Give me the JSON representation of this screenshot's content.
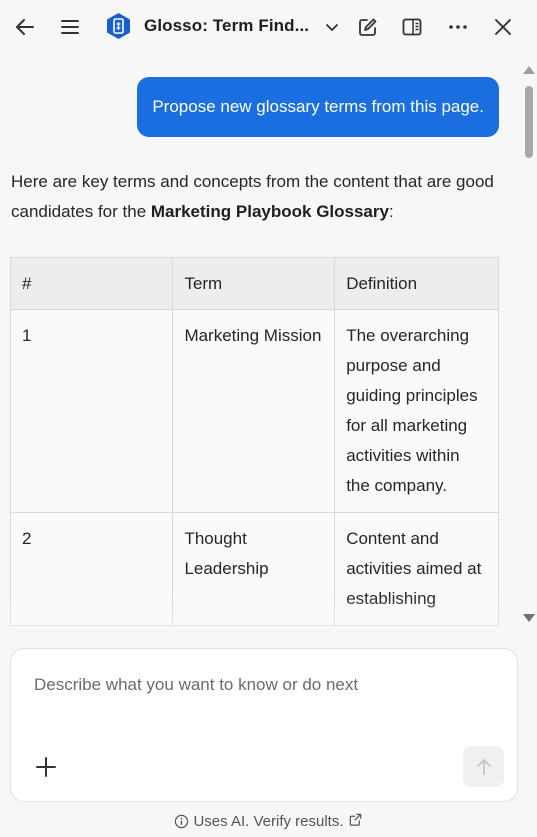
{
  "header": {
    "app_title": "Glosso: Term Find...",
    "icons": [
      "back-arrow-icon",
      "menu-icon",
      "app-logo",
      "chevron-down-icon",
      "edit-icon",
      "sidebar-toggle-icon",
      "more-icon",
      "close-icon"
    ]
  },
  "conversation": {
    "user_message": "Propose new glossary terms from this page.",
    "reply_intro": "Here are key terms and concepts from the content that are good candidates for the ",
    "reply_bold": "Marketing Playbook Glossary",
    "reply_end": ":",
    "table": {
      "headers": [
        "#",
        "Term",
        "Definition"
      ],
      "rows": [
        {
          "num": "1",
          "term": "Marketing Mission",
          "definition": "The overarching purpose and guiding principles for all marketing activities within the company."
        },
        {
          "num": "2",
          "term": "Thought Leadership",
          "definition": "Content and activities aimed at establishing"
        }
      ]
    }
  },
  "composer": {
    "placeholder": "Describe what you want to know or do next",
    "icons": [
      "plus-icon",
      "send-arrow-icon"
    ]
  },
  "footer": {
    "text": "Uses AI. Verify results.",
    "icons": [
      "info-icon",
      "external-link-icon"
    ]
  },
  "colors": {
    "accent": "#1a6ee0",
    "background": "#f7f7f7"
  }
}
